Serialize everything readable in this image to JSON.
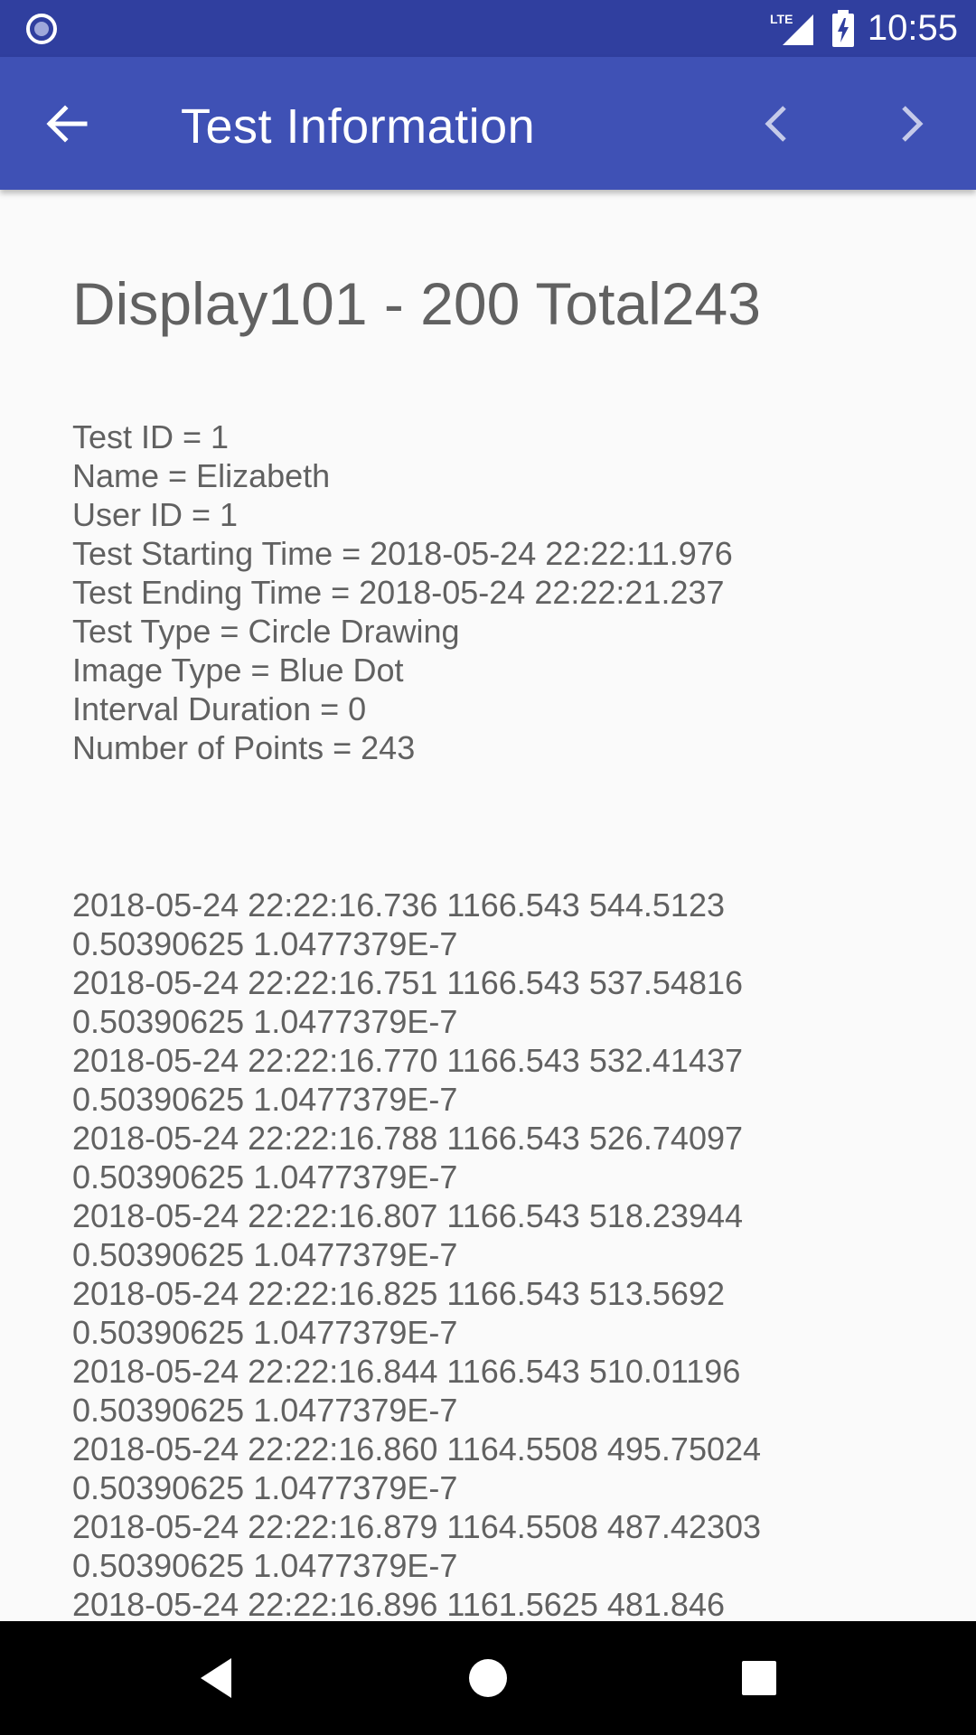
{
  "status_bar": {
    "time": "10:55",
    "network_label": "LTE",
    "icons": [
      "notification-icon",
      "signal-icon",
      "battery-charging-icon"
    ]
  },
  "app_bar": {
    "title": "Test Information",
    "icons": [
      "back-arrow-icon",
      "chevron-left-icon",
      "chevron-right-icon"
    ]
  },
  "heading": "Display101 - 200 Total243",
  "info": [
    "Test ID = 1",
    "Name = Elizabeth",
    "User ID = 1",
    "Test Starting Time = 2018-05-24 22:22:11.976",
    "Test Ending Time = 2018-05-24 22:22:21.237",
    "Test Type = Circle Drawing",
    "Image Type = Blue Dot",
    "Interval Duration = 0",
    "Number of Points = 243"
  ],
  "data_lines": [
    "2018-05-24 22:22:16.736 1166.543 544.5123",
    "0.50390625 1.0477379E-7",
    "2018-05-24 22:22:16.751 1166.543 537.54816",
    "0.50390625 1.0477379E-7",
    "2018-05-24 22:22:16.770 1166.543 532.41437",
    "0.50390625 1.0477379E-7",
    "2018-05-24 22:22:16.788 1166.543 526.74097",
    "0.50390625 1.0477379E-7",
    "2018-05-24 22:22:16.807 1166.543 518.23944",
    "0.50390625 1.0477379E-7",
    "2018-05-24 22:22:16.825 1166.543 513.5692",
    "0.50390625 1.0477379E-7",
    "2018-05-24 22:22:16.844 1166.543 510.01196",
    "0.50390625 1.0477379E-7",
    "2018-05-24 22:22:16.860 1164.5508 495.75024",
    "0.50390625 1.0477379E-7",
    "2018-05-24 22:22:16.879 1164.5508 487.42303",
    "0.50390625 1.0477379E-7",
    "2018-05-24 22:22:16.896 1161.5625 481.846"
  ],
  "nav_bar": {
    "icons": [
      "nav-back-icon",
      "nav-home-icon",
      "nav-recents-icon"
    ]
  },
  "colors": {
    "status_bar": "#303f9f",
    "app_bar": "#3f51b5",
    "background": "#fafafa",
    "text": "#616161",
    "nav_bar": "#000000"
  }
}
